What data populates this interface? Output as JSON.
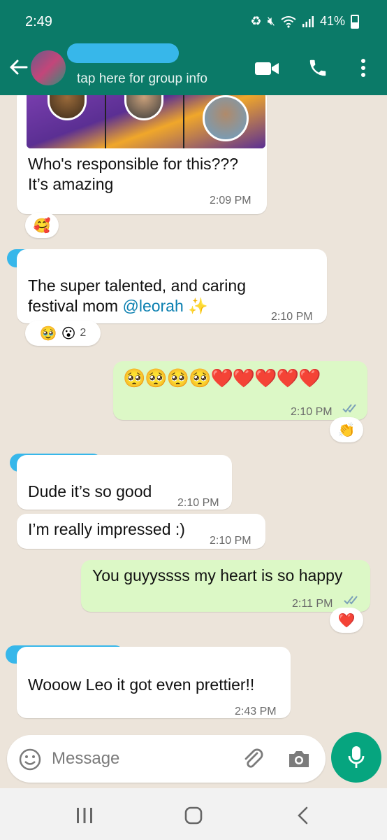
{
  "status_bar": {
    "time": "2:49",
    "battery": "41%"
  },
  "header": {
    "subtitle": "tap here for group info"
  },
  "messages": [
    {
      "line1": "Who's responsible for this???",
      "line2": "It’s amazing",
      "time": "2:09 PM",
      "reactions": [
        "🥰"
      ]
    },
    {
      "line1": "The super talented, and caring",
      "line2_prefix": "festival mom ",
      "mention": "@leorah",
      "line2_suffix": " ✨",
      "time": "2:10 PM",
      "reactions": [
        "🥹",
        "😮"
      ],
      "reaction_count": "2"
    },
    {
      "text": "🥺🥺🥺🥺❤️❤️❤️❤️❤️",
      "time": "2:10 PM",
      "reactions": [
        "👏"
      ]
    },
    {
      "text": "Dude it’s so good",
      "time": "2:10 PM"
    },
    {
      "text": "I’m really impressed :)",
      "time": "2:10 PM"
    },
    {
      "text": "You guyyssss my heart is so happy",
      "time": "2:11 PM",
      "reactions": [
        "❤️"
      ]
    },
    {
      "text": "Wooow Leo it got even prettier!!",
      "time": "2:43 PM"
    }
  ],
  "input": {
    "placeholder": "Message"
  },
  "icons": {
    "back": "arrow-left",
    "video": "video-camera",
    "call": "phone",
    "menu": "more-vertical",
    "emoji": "emoji",
    "attach": "paperclip",
    "camera": "camera",
    "mic": "microphone",
    "nav_recents": "recents",
    "nav_home": "home",
    "nav_back": "back"
  },
  "colors": {
    "header": "#0b7a68",
    "incoming": "#ffffff",
    "outgoing": "#dcf8c6",
    "mic": "#06a57f",
    "mention": "#0a7fb0",
    "read_ticks": "#7aa0b8"
  }
}
